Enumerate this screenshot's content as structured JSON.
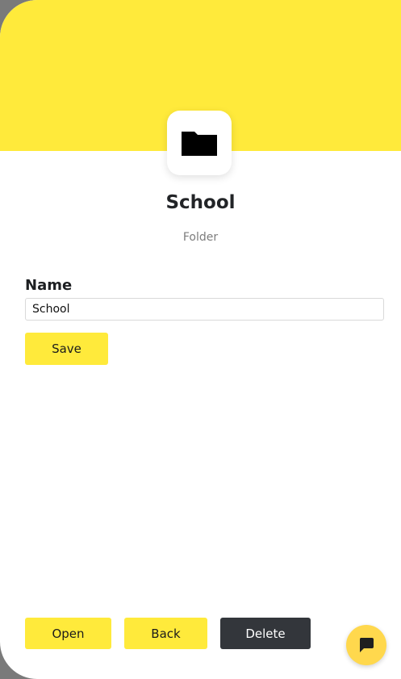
{
  "colors": {
    "accent": "#ffea3b",
    "dark_button": "#33363b",
    "chat_button": "#ffd84d",
    "backdrop": "#7a7a7a"
  },
  "header": {
    "icon": "folder-icon",
    "title": "School",
    "subtitle": "Folder"
  },
  "form": {
    "name_label": "Name",
    "name_value": "School",
    "save_label": "Save"
  },
  "actions": {
    "open_label": "Open",
    "back_label": "Back",
    "delete_label": "Delete"
  },
  "chat": {
    "icon": "chat-bubble-icon"
  }
}
